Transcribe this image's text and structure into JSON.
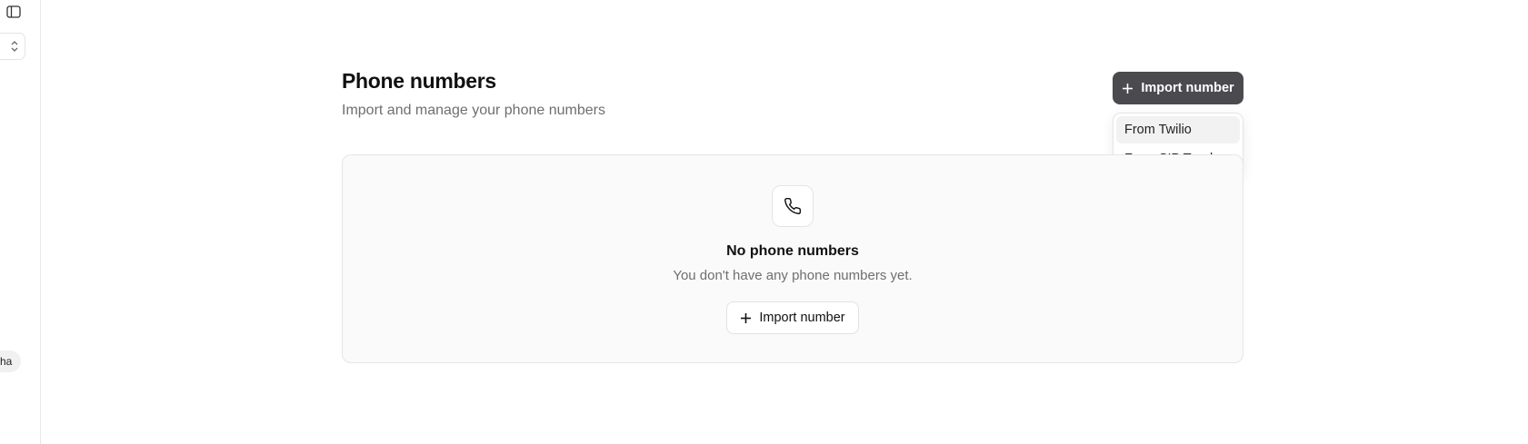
{
  "sidebar": {
    "toggle_icon": "sidebar-panel-icon",
    "switcher_icon": "chevron-up-down-icon",
    "plan_badge": "ha"
  },
  "header": {
    "title": "Phone numbers",
    "subtitle": "Import and manage your phone numbers",
    "import_button_label": "Import number"
  },
  "dropdown": {
    "items": [
      {
        "label": "From Twilio",
        "highlighted": true
      },
      {
        "label": "From SIP Trunk",
        "highlighted": false
      }
    ]
  },
  "empty_state": {
    "icon": "phone-icon",
    "title": "No phone numbers",
    "description": "You don't have any phone numbers yet.",
    "button_label": "Import number"
  },
  "colors": {
    "primary_button_bg": "#4a4a4f",
    "card_bg": "#fafafa",
    "muted_text": "#6f6f6f"
  }
}
